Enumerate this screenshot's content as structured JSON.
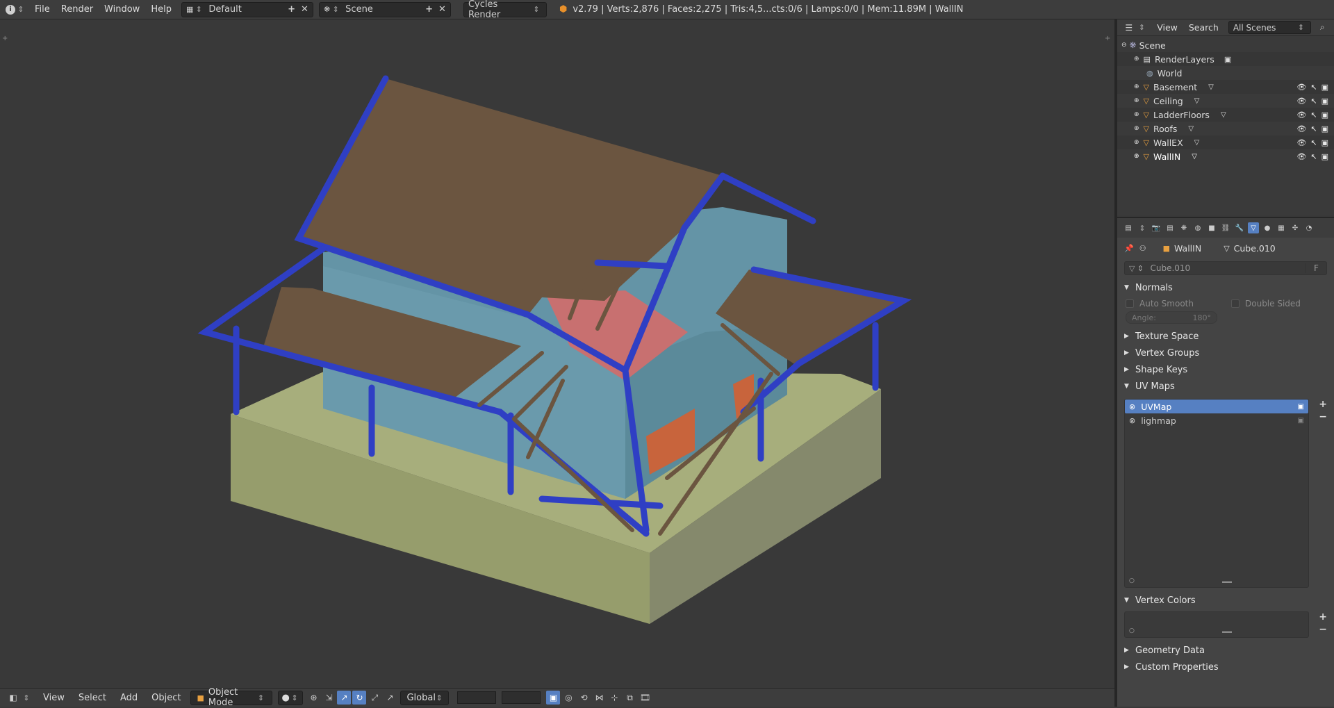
{
  "topbar": {
    "menus": [
      "File",
      "Render",
      "Window",
      "Help"
    ],
    "layout": "Default",
    "scene": "Scene",
    "engine": "Cycles Render",
    "stats": "v2.79 | Verts:2,876 | Faces:2,275 | Tris:4,5...cts:0/6 | Lamps:0/0 | Mem:11.89M | WallIN"
  },
  "bottombar": {
    "menus": [
      "View",
      "Select",
      "Add",
      "Object"
    ],
    "mode": "Object Mode",
    "orientation": "Global"
  },
  "outliner": {
    "menus": [
      "View",
      "Search"
    ],
    "filter": "All Scenes",
    "items": [
      {
        "name": "Scene",
        "kind": "scene"
      },
      {
        "name": "RenderLayers",
        "kind": "renderlayer"
      },
      {
        "name": "World",
        "kind": "world"
      },
      {
        "name": "Basement",
        "kind": "mesh"
      },
      {
        "name": "Ceiling",
        "kind": "mesh"
      },
      {
        "name": "LadderFloors",
        "kind": "mesh"
      },
      {
        "name": "Roofs",
        "kind": "mesh"
      },
      {
        "name": "WallEX",
        "kind": "mesh"
      },
      {
        "name": "WallIN",
        "kind": "mesh"
      }
    ]
  },
  "properties": {
    "breadcrumb_object": "WallIN",
    "breadcrumb_data": "Cube.010",
    "datablock_name": "Cube.010",
    "fake_user": "F",
    "normals": {
      "title": "Normals",
      "auto_smooth": "Auto Smooth",
      "double_sided": "Double Sided",
      "angle_label": "Angle:",
      "angle_value": "180°"
    },
    "collapsed_panels": [
      "Texture Space",
      "Vertex Groups",
      "Shape Keys"
    ],
    "uv_maps": {
      "title": "UV Maps",
      "items": [
        "UVMap",
        "lighmap"
      ],
      "selected": "UVMap"
    },
    "vertex_colors": {
      "title": "Vertex Colors"
    },
    "bottom_panels": [
      "Geometry Data",
      "Custom Properties"
    ]
  },
  "colors": {
    "accent": "#5680c2",
    "roof": "#6b5540",
    "wall": "#6494a6",
    "base": "#a7ae7c",
    "frame": "#2f3fc4"
  }
}
